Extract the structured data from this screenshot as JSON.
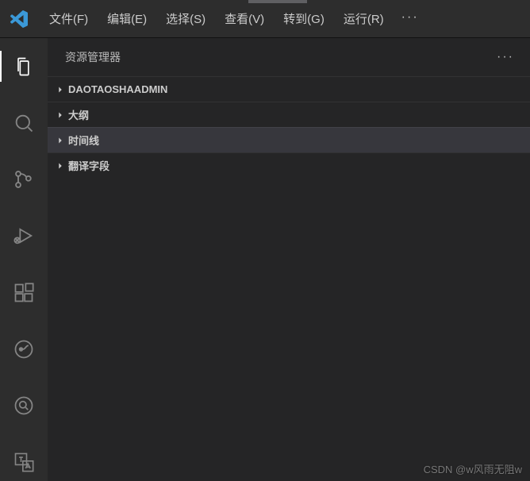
{
  "menu": {
    "file": "文件(F)",
    "edit": "编辑(E)",
    "selection": "选择(S)",
    "view": "查看(V)",
    "go": "转到(G)",
    "run": "运行(R)",
    "overflow": "···"
  },
  "sidebar": {
    "title": "资源管理器",
    "more": "···",
    "sections": {
      "project": "DAOTAOSHAADMIN",
      "outline": "大纲",
      "timeline": "时间线",
      "translate": "翻译字段"
    }
  },
  "watermark": "CSDN @w风雨无阻w"
}
